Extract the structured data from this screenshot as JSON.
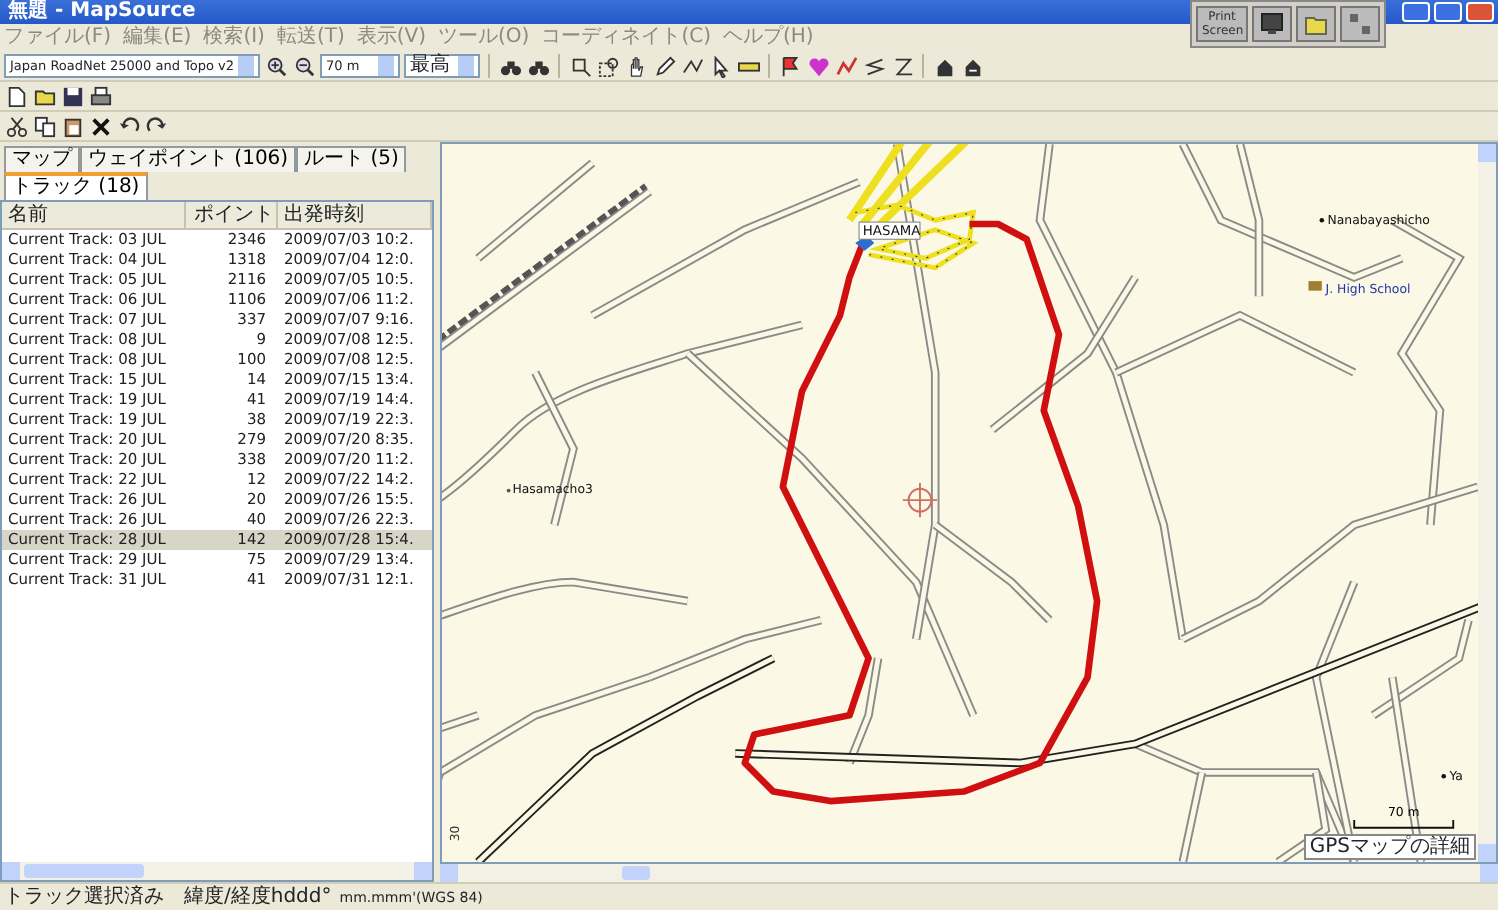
{
  "window": {
    "title": "無題 - MapSource"
  },
  "menu": [
    "ファイル(F)",
    "編集(E)",
    "検索(I)",
    "転送(T)",
    "表示(V)",
    "ツール(O)",
    "コーディネイト(C)",
    "ヘルプ(H)"
  ],
  "toolbar": {
    "map_product": "Japan RoadNet 25000 and Topo v2",
    "zoom": "70 m",
    "detail": "最高"
  },
  "screen_manager": {
    "print_button": "Print Screen"
  },
  "tabs": [
    {
      "label": "マップ",
      "selected": false
    },
    {
      "label": "ウェイポイント (106)",
      "selected": false
    },
    {
      "label": "ルート (5)",
      "selected": false
    },
    {
      "label": "トラック (18)",
      "selected": true
    }
  ],
  "track_table": {
    "columns": [
      "名前",
      "ポイント",
      "出発時刻"
    ],
    "rows": [
      {
        "name": "Current Track: 03 JUL",
        "points": "2346",
        "start": "2009/07/03 10:2.",
        "selected": false
      },
      {
        "name": "Current Track: 04 JUL",
        "points": "1318",
        "start": "2009/07/04 12:0.",
        "selected": false
      },
      {
        "name": "Current Track: 05 JUL",
        "points": "2116",
        "start": "2009/07/05 10:5.",
        "selected": false
      },
      {
        "name": "Current Track: 06 JUL",
        "points": "1106",
        "start": "2009/07/06 11:2.",
        "selected": false
      },
      {
        "name": "Current Track: 07 JUL",
        "points": "337",
        "start": "2009/07/07 9:16.",
        "selected": false
      },
      {
        "name": "Current Track: 08 JUL",
        "points": "9",
        "start": "2009/07/08 12:5.",
        "selected": false
      },
      {
        "name": "Current Track: 08 JUL",
        "points": "100",
        "start": "2009/07/08 12:5.",
        "selected": false
      },
      {
        "name": "Current Track: 15 JUL",
        "points": "14",
        "start": "2009/07/15 13:4.",
        "selected": false
      },
      {
        "name": "Current Track: 19 JUL",
        "points": "41",
        "start": "2009/07/19 14:4.",
        "selected": false
      },
      {
        "name": "Current Track: 19 JUL",
        "points": "38",
        "start": "2009/07/19 22:3.",
        "selected": false
      },
      {
        "name": "Current Track: 20 JUL",
        "points": "279",
        "start": "2009/07/20 8:35.",
        "selected": false
      },
      {
        "name": "Current Track: 20 JUL",
        "points": "338",
        "start": "2009/07/20 11:2.",
        "selected": false
      },
      {
        "name": "Current Track: 22 JUL",
        "points": "12",
        "start": "2009/07/22 14:2.",
        "selected": false
      },
      {
        "name": "Current Track: 26 JUL",
        "points": "20",
        "start": "2009/07/26 15:5.",
        "selected": false
      },
      {
        "name": "Current Track: 26 JUL",
        "points": "40",
        "start": "2009/07/26 22:3.",
        "selected": false
      },
      {
        "name": "Current Track: 28 JUL",
        "points": "142",
        "start": "2009/07/28 15:4.",
        "selected": true
      },
      {
        "name": "Current Track: 29 JUL",
        "points": "75",
        "start": "2009/07/29 13:4.",
        "selected": false
      },
      {
        "name": "Current Track: 31 JUL",
        "points": "41",
        "start": "2009/07/31 12:1.",
        "selected": false
      }
    ]
  },
  "map": {
    "labels": [
      {
        "text": "HASAMA",
        "kind": "waypoint"
      },
      {
        "text": "Nanabayashicho",
        "kind": "place"
      },
      {
        "text": "J. High School",
        "kind": "school"
      },
      {
        "text": "Hasamacho3",
        "kind": "place"
      },
      {
        "text": "30",
        "kind": "road-number"
      },
      {
        "text": "Ya",
        "kind": "place"
      }
    ],
    "scale": "70 m",
    "detail_label": "GPSマップの詳細"
  },
  "status_bar": [
    "トラック選択済み",
    "緯度/経度hddd°",
    "mm.mmm'(WGS 84)"
  ]
}
